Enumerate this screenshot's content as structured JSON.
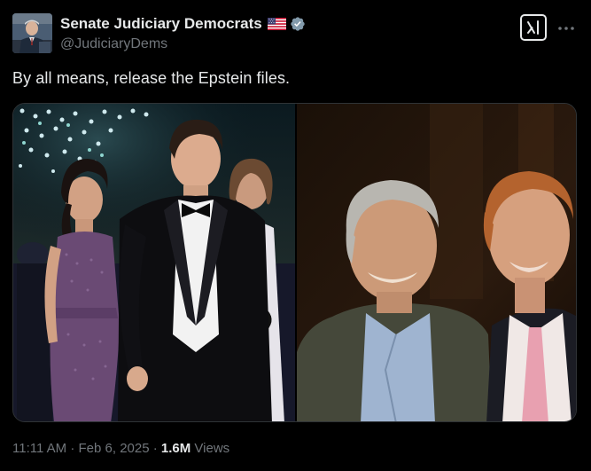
{
  "author": {
    "display_name": "Senate Judiciary Democrats",
    "handle": "@JudiciaryDems",
    "flag_icon": "us-flag-icon",
    "verified_icon": "verified-badge-icon",
    "verified_color": "#829aab"
  },
  "header_actions": {
    "grok_icon": "grok-icon",
    "more_label": "···"
  },
  "post": {
    "text": "By all means, release the Epstein files."
  },
  "media": {
    "photo_count": 2
  },
  "meta": {
    "time": "11:11 AM",
    "separator_1": " · ",
    "date": "Feb 6, 2025",
    "separator_2": " · ",
    "views_count": "1.6M",
    "views_label": " Views"
  },
  "colors": {
    "background": "#000000",
    "text_primary": "#e7e9ea",
    "text_secondary": "#71767b",
    "border": "#2f3336"
  }
}
